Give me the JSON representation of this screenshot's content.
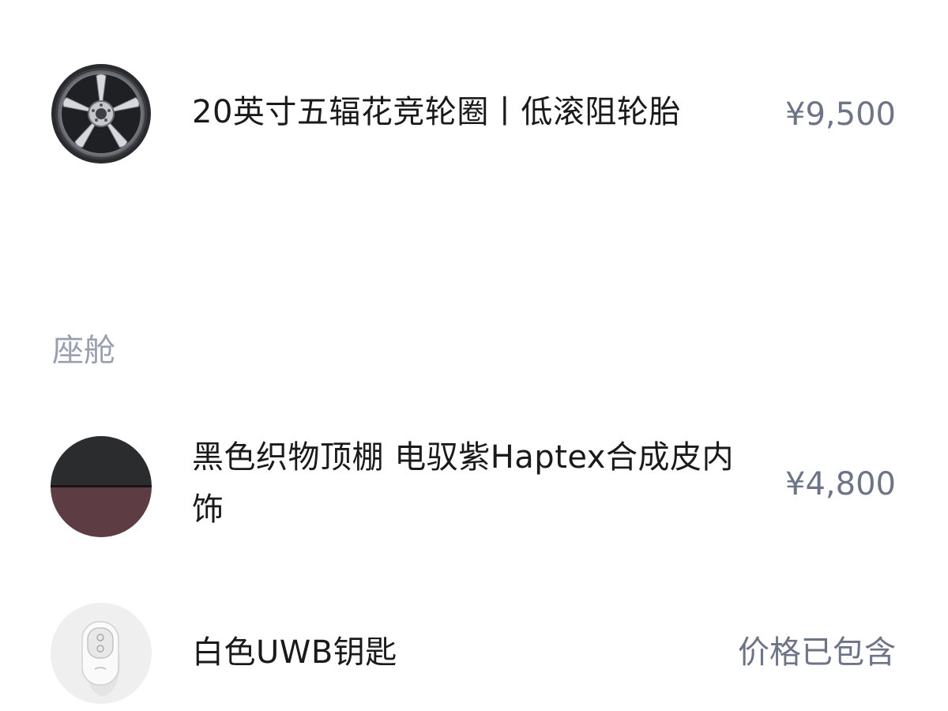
{
  "items": [
    {
      "icon": "wheel-rim-icon",
      "name": "20英寸五辐花竞轮圈丨低滚阻轮胎",
      "price": "¥9,500"
    },
    {
      "icon": "interior-color-swatch",
      "name": "黑色织物顶棚 电驭紫Haptex合成皮内饰",
      "price": "¥4,800"
    },
    {
      "icon": "uwb-key-icon",
      "name": "白色UWB钥匙",
      "price": "价格已包含"
    }
  ],
  "section": {
    "title": "座舱"
  },
  "colors": {
    "price_text": "#6e7487",
    "section_title": "#9a9faf",
    "swatch_top": "#2b2c2e",
    "swatch_bottom": "#5e3c44"
  }
}
